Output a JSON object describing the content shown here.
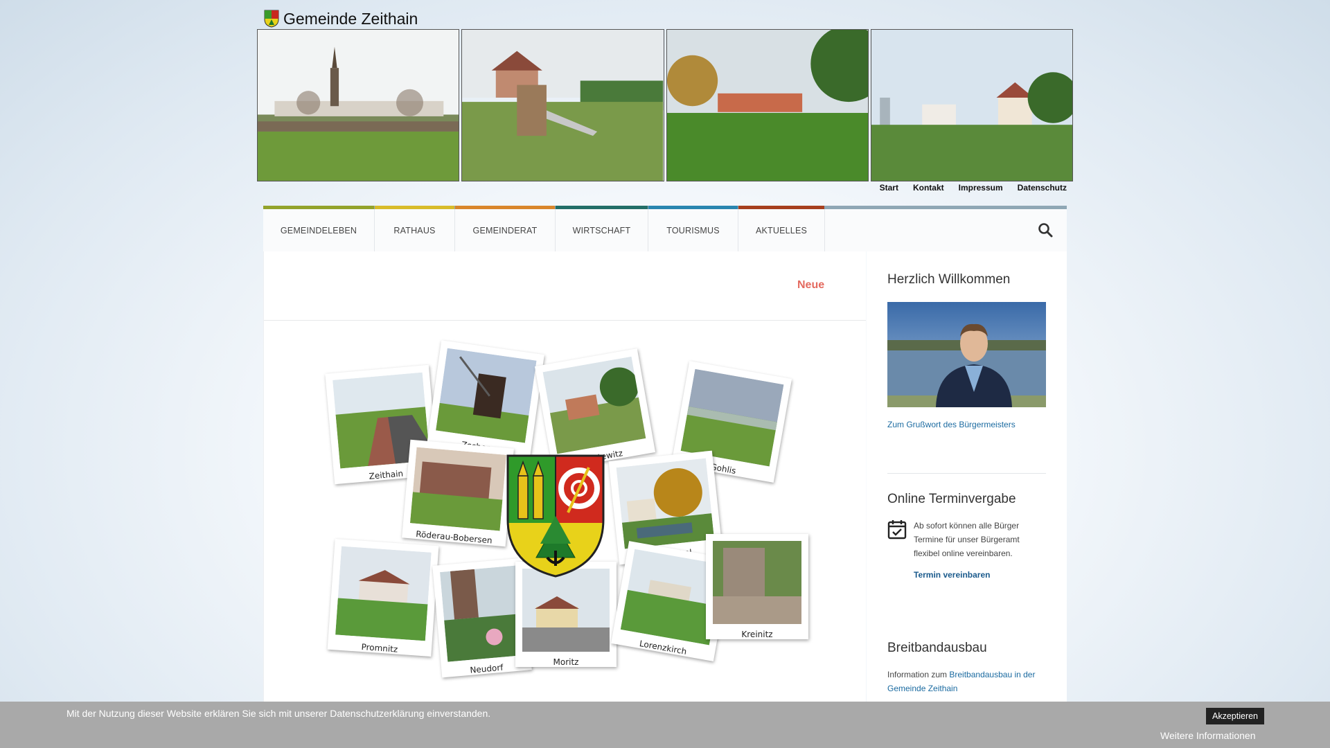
{
  "site": {
    "title": "Gemeinde Zeithain"
  },
  "top_links": [
    "Start",
    "Kontakt",
    "Impressum",
    "Datenschutz"
  ],
  "nav": [
    "Gemeindeleben",
    "Rathaus",
    "Gemeinderat",
    "Wirtschaft",
    "Tourismus",
    "Aktuelles"
  ],
  "ticker": {
    "text": "Neue"
  },
  "collage": {
    "places": [
      "Zeithain",
      "Zschepa",
      "Cottewitz",
      "Gohlis",
      "Röderau-Bobersen",
      "Jacobsthal",
      "Promnitz",
      "Neudorf",
      "Moritz",
      "Lorenzkirch",
      "Kreinitz"
    ]
  },
  "sidebar": {
    "welcome": {
      "heading": "Herzlich Willkommen",
      "link": "Zum Grußwort des Bürgermeisters"
    },
    "termin": {
      "heading": "Online Terminvergabe",
      "text": "Ab sofort können alle Bürger Termine für unser Bürgeramt flexibel online vereinbaren.",
      "button": "Termin vereinbaren"
    },
    "breitband": {
      "heading": "Breitbandausbau",
      "text_prefix": "Information zum ",
      "link": "Breitbandausbau in der Gemeinde Zeithain"
    }
  },
  "cookie": {
    "message": "Mit der Nutzung dieser Website erklären Sie sich mit unserer Datenschutzerklärung einverstanden.",
    "accept": "Akzeptieren",
    "more": "Weitere Informationen"
  }
}
